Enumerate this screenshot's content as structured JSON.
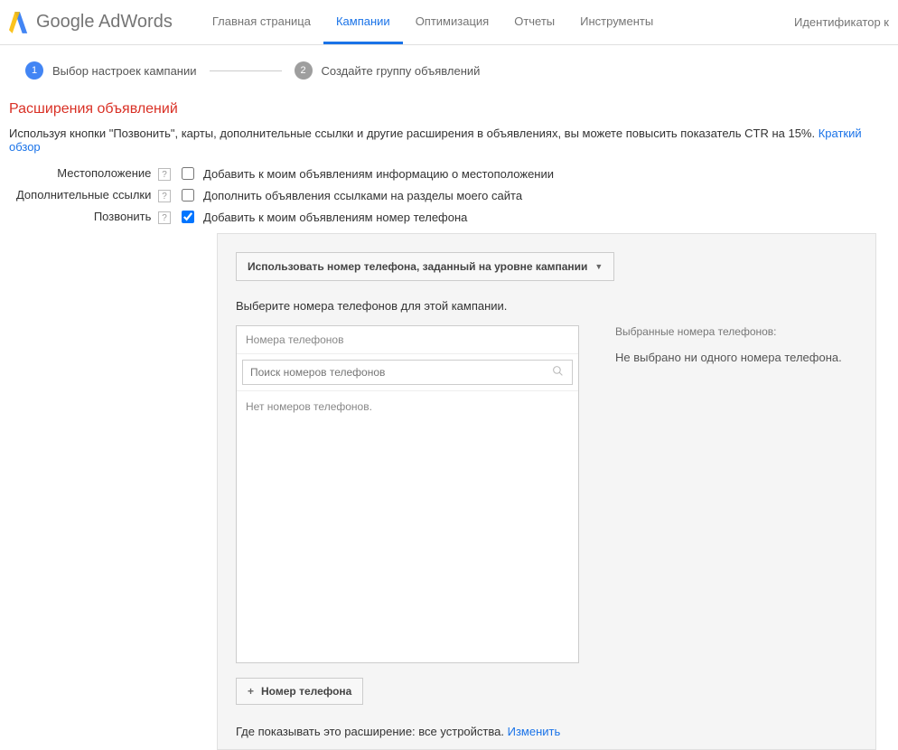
{
  "header": {
    "logo_text_google": "Google",
    "logo_text_adwords": " AdWords",
    "nav": [
      "Главная страница",
      "Кампании",
      "Оптимизация",
      "Отчеты",
      "Инструменты"
    ],
    "active_nav_index": 1,
    "right_text": "Идентификатор к"
  },
  "stepper": {
    "step1_num": "1",
    "step1_label": "Выбор настроек кампании",
    "step2_num": "2",
    "step2_label": "Создайте группу объявлений"
  },
  "section": {
    "title": "Расширения объявлений",
    "desc": "Используя кнопки \"Позвонить\", карты, дополнительные ссылки и другие расширения в объявлениях, вы можете повысить показатель CTR на 15%. ",
    "desc_link": "Краткий обзор"
  },
  "options": {
    "location_label": "Местоположение",
    "location_text": "Добавить к моим объявлениям информацию о местоположении",
    "location_checked": false,
    "sitelinks_label": "Дополнительные ссылки",
    "sitelinks_text": "Дополнить объявления ссылками на разделы моего сайта",
    "sitelinks_checked": false,
    "call_label": "Позвонить",
    "call_text": "Добавить к моим объявлениям номер телефона",
    "call_checked": true,
    "help_glyph": "?"
  },
  "phone_panel": {
    "dropdown_label": "Использовать номер телефона, заданный на уровне кампании",
    "subtitle": "Выберите номера телефонов для этой кампании.",
    "box_header": "Номера телефонов",
    "search_placeholder": "Поиск номеров телефонов",
    "empty_text": "Нет номеров телефонов.",
    "selected_title": "Выбранные номера телефонов:",
    "selected_empty": "Не выбрано ни одного номера телефона.",
    "add_btn": "Номер телефона",
    "where_prefix": "Где показывать это расширение: ",
    "where_value": "все устройства.  ",
    "where_change": "Изменить"
  }
}
